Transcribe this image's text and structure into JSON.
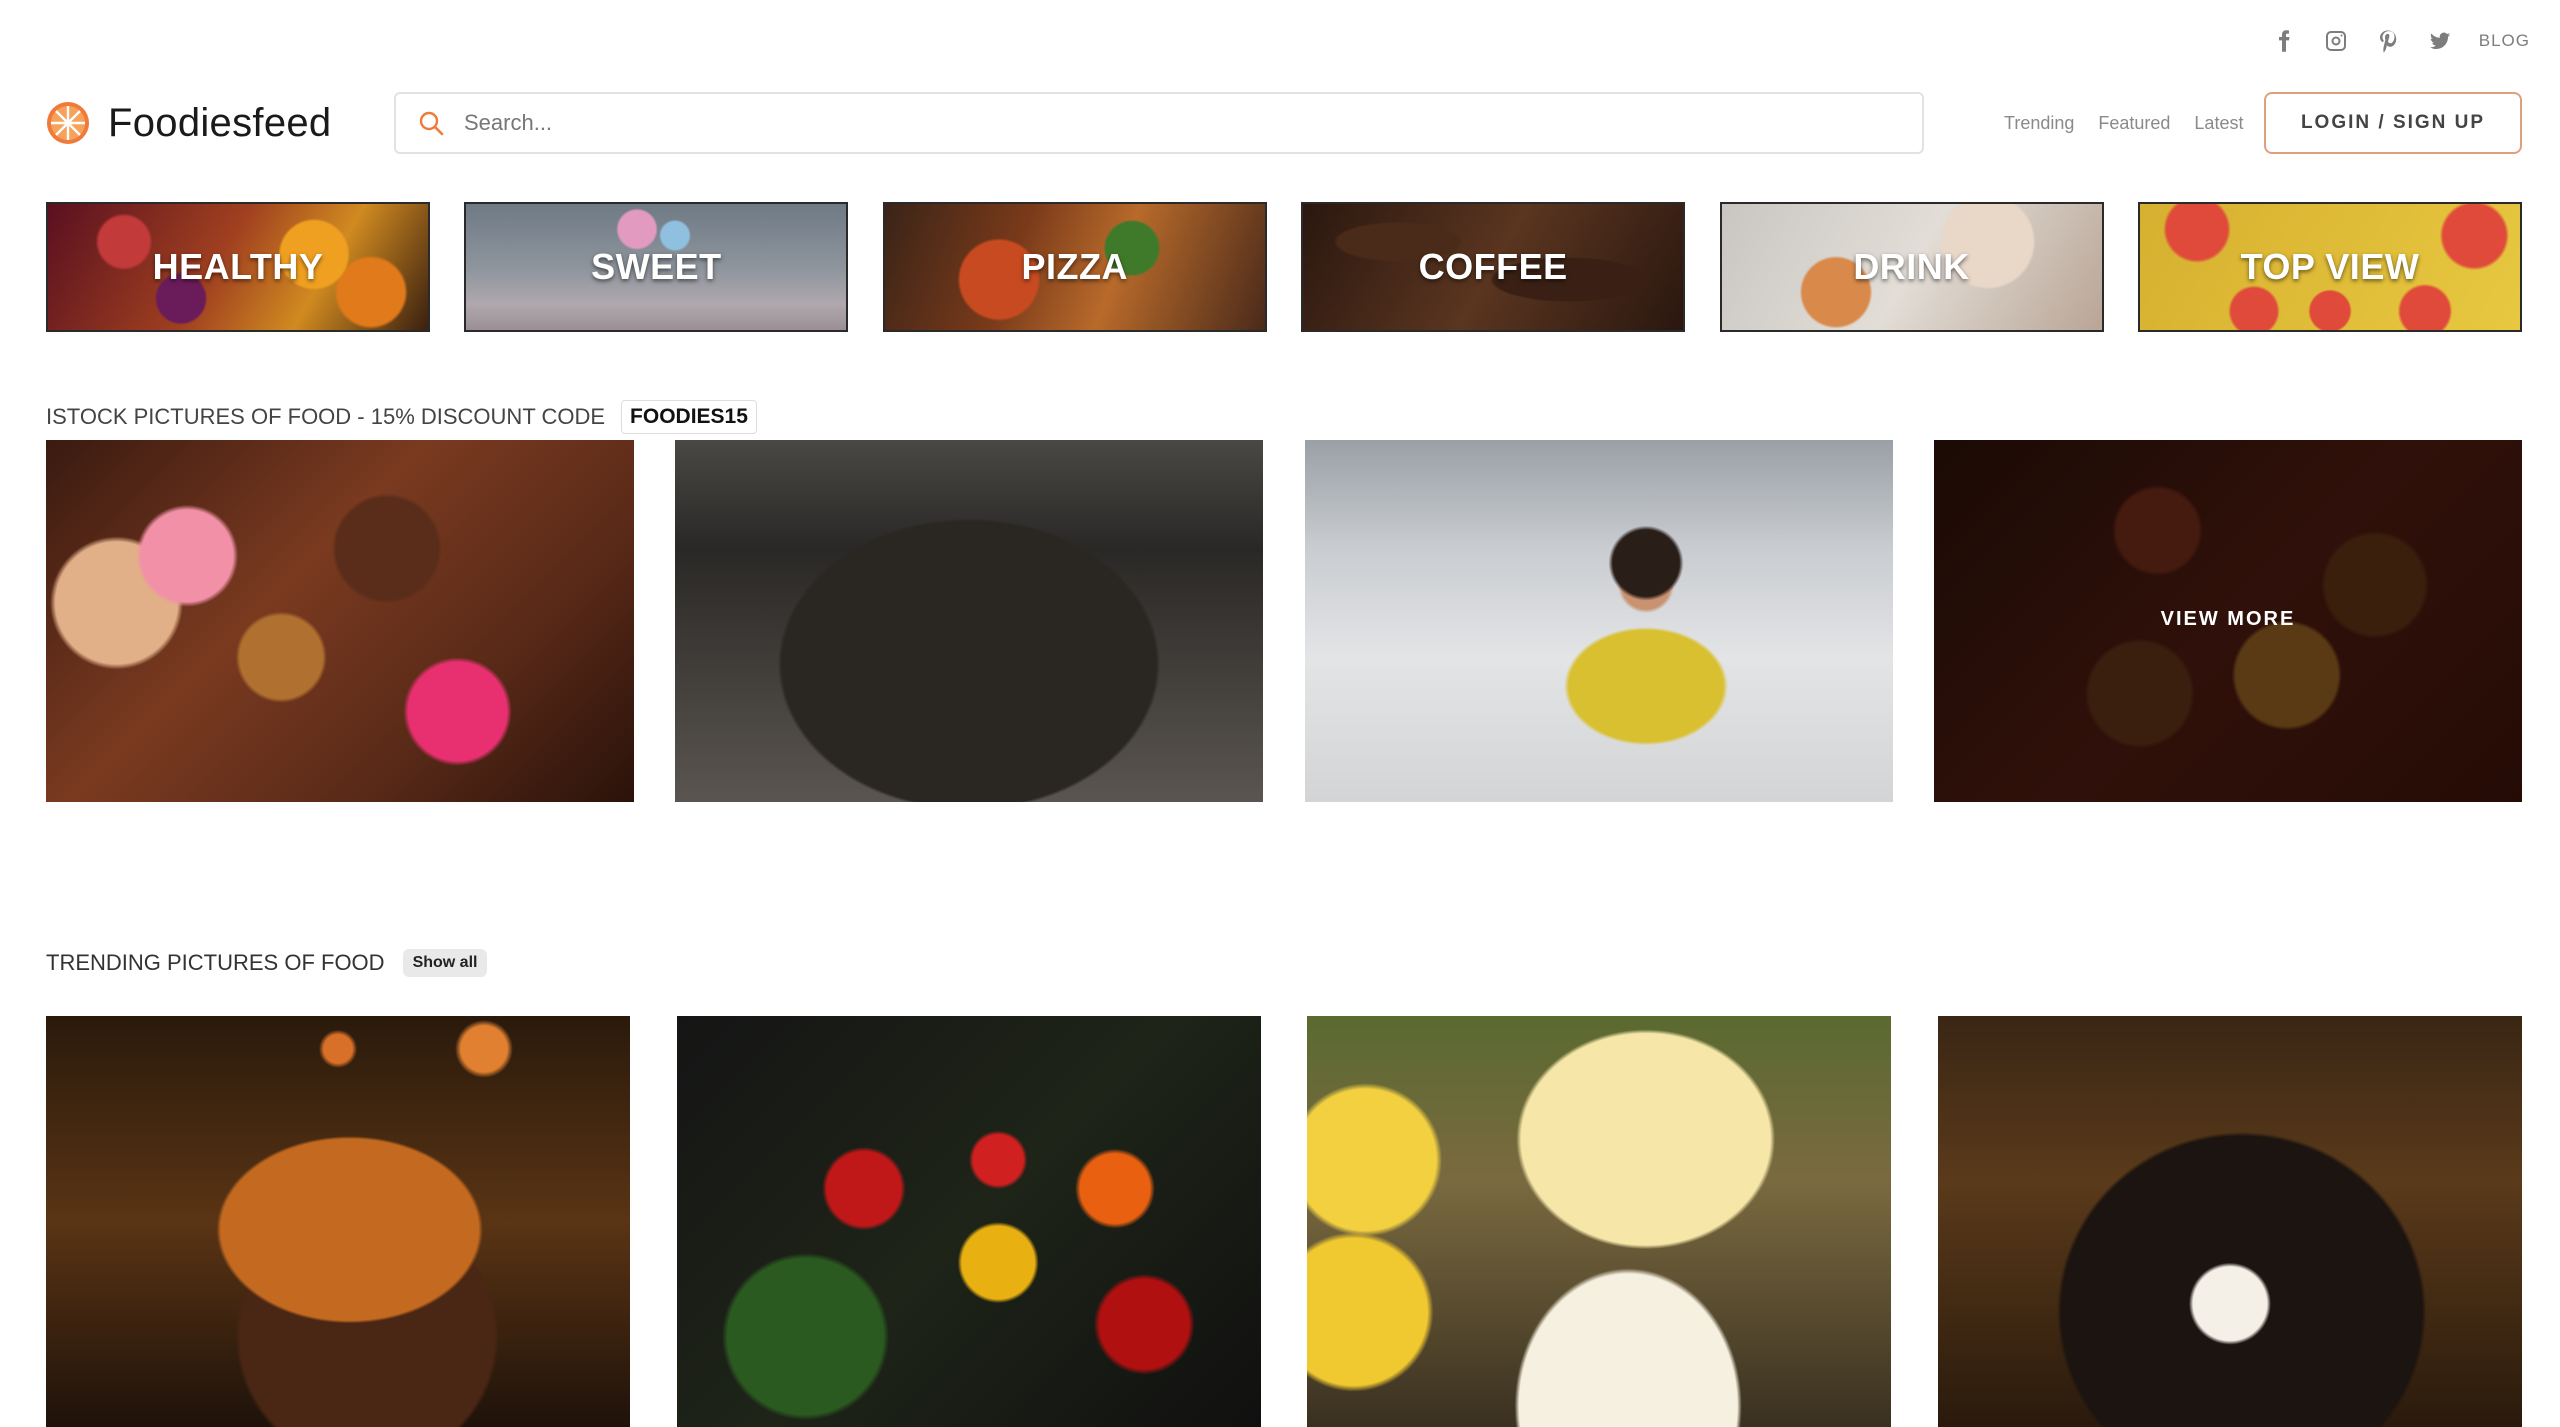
{
  "header": {
    "social": [
      {
        "icon": "facebook-icon"
      },
      {
        "icon": "instagram-icon"
      },
      {
        "icon": "pinterest-icon"
      },
      {
        "icon": "twitter-icon"
      }
    ],
    "blog_label": "BLOG",
    "logo_text": "Foodiesfeed",
    "search_placeholder": "Search...",
    "nav": [
      "Trending",
      "Featured",
      "Latest"
    ],
    "login_label": "LOGIN / SIGN UP"
  },
  "categories": [
    "HEALTHY",
    "SWEET",
    "PIZZA",
    "COFFEE",
    "DRINK",
    "TOP VIEW"
  ],
  "promo": {
    "title": "ISTOCK PICTURES OF FOOD - 15% DISCOUNT CODE",
    "code": "FOODIES15",
    "view_more": "VIEW MORE"
  },
  "trending": {
    "title": "TRENDING PICTURES OF FOOD",
    "show_all": "Show all"
  },
  "colors": {
    "brand_orange": "#f07a3a",
    "login_border": "#e0a080",
    "muted_text": "#8a8a8a"
  }
}
